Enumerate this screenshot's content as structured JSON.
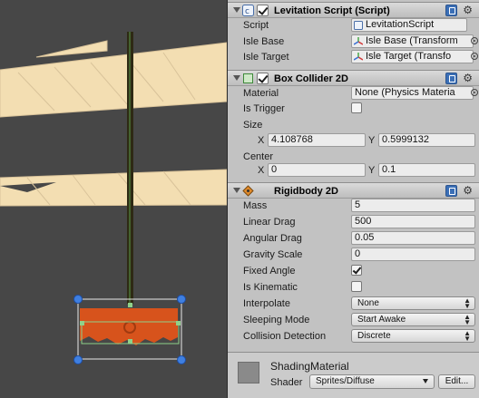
{
  "colors": {
    "scene_bg": "#474747",
    "platform_fill": "#f3deb2",
    "platform_edge": "#d9c39a",
    "post": "#2e2a14",
    "isle_orange": "#d7531c",
    "collider_green": "#8fd18a",
    "handle_blue": "#3f7fe0"
  },
  "levitation_script": {
    "title": "Levitation Script (Script)",
    "script_label": "Script",
    "script_value": "LevitationScript",
    "isle_base_label": "Isle Base",
    "isle_base_value": "Isle Base (Transform",
    "isle_target_label": "Isle Target",
    "isle_target_value": "Isle Target (Transfo"
  },
  "box_collider": {
    "title": "Box Collider 2D",
    "material_label": "Material",
    "material_value": "None (Physics Materia",
    "is_trigger_label": "Is Trigger",
    "is_trigger": false,
    "size_label": "Size",
    "size_x_label": "X",
    "size_x": "4.108768",
    "size_y_label": "Y",
    "size_y": "0.5999132",
    "center_label": "Center",
    "center_x_label": "X",
    "center_x": "0",
    "center_y_label": "Y",
    "center_y": "0.1"
  },
  "rigidbody": {
    "title": "Rigidbody 2D",
    "mass_label": "Mass",
    "mass": "5",
    "linear_drag_label": "Linear Drag",
    "linear_drag": "500",
    "angular_drag_label": "Angular Drag",
    "angular_drag": "0.05",
    "gravity_scale_label": "Gravity Scale",
    "gravity_scale": "0",
    "fixed_angle_label": "Fixed Angle",
    "fixed_angle": true,
    "is_kinematic_label": "Is Kinematic",
    "is_kinematic": false,
    "interpolate_label": "Interpolate",
    "interpolate": "None",
    "sleeping_mode_label": "Sleeping Mode",
    "sleeping_mode": "Start Awake",
    "collision_detection_label": "Collision Detection",
    "collision_detection": "Discrete"
  },
  "material": {
    "name": "ShadingMaterial",
    "shader_label": "Shader",
    "shader_value": "Sprites/Diffuse",
    "edit_label": "Edit..."
  },
  "icons": {
    "fold": "foldout-arrow-icon",
    "script": "script-icon",
    "collider": "box-collider-icon",
    "rigidbody": "rigidbody-icon",
    "help": "help-book-icon",
    "gear": "gear-icon",
    "transform": "transform-icon",
    "picker": "object-picker-icon"
  }
}
